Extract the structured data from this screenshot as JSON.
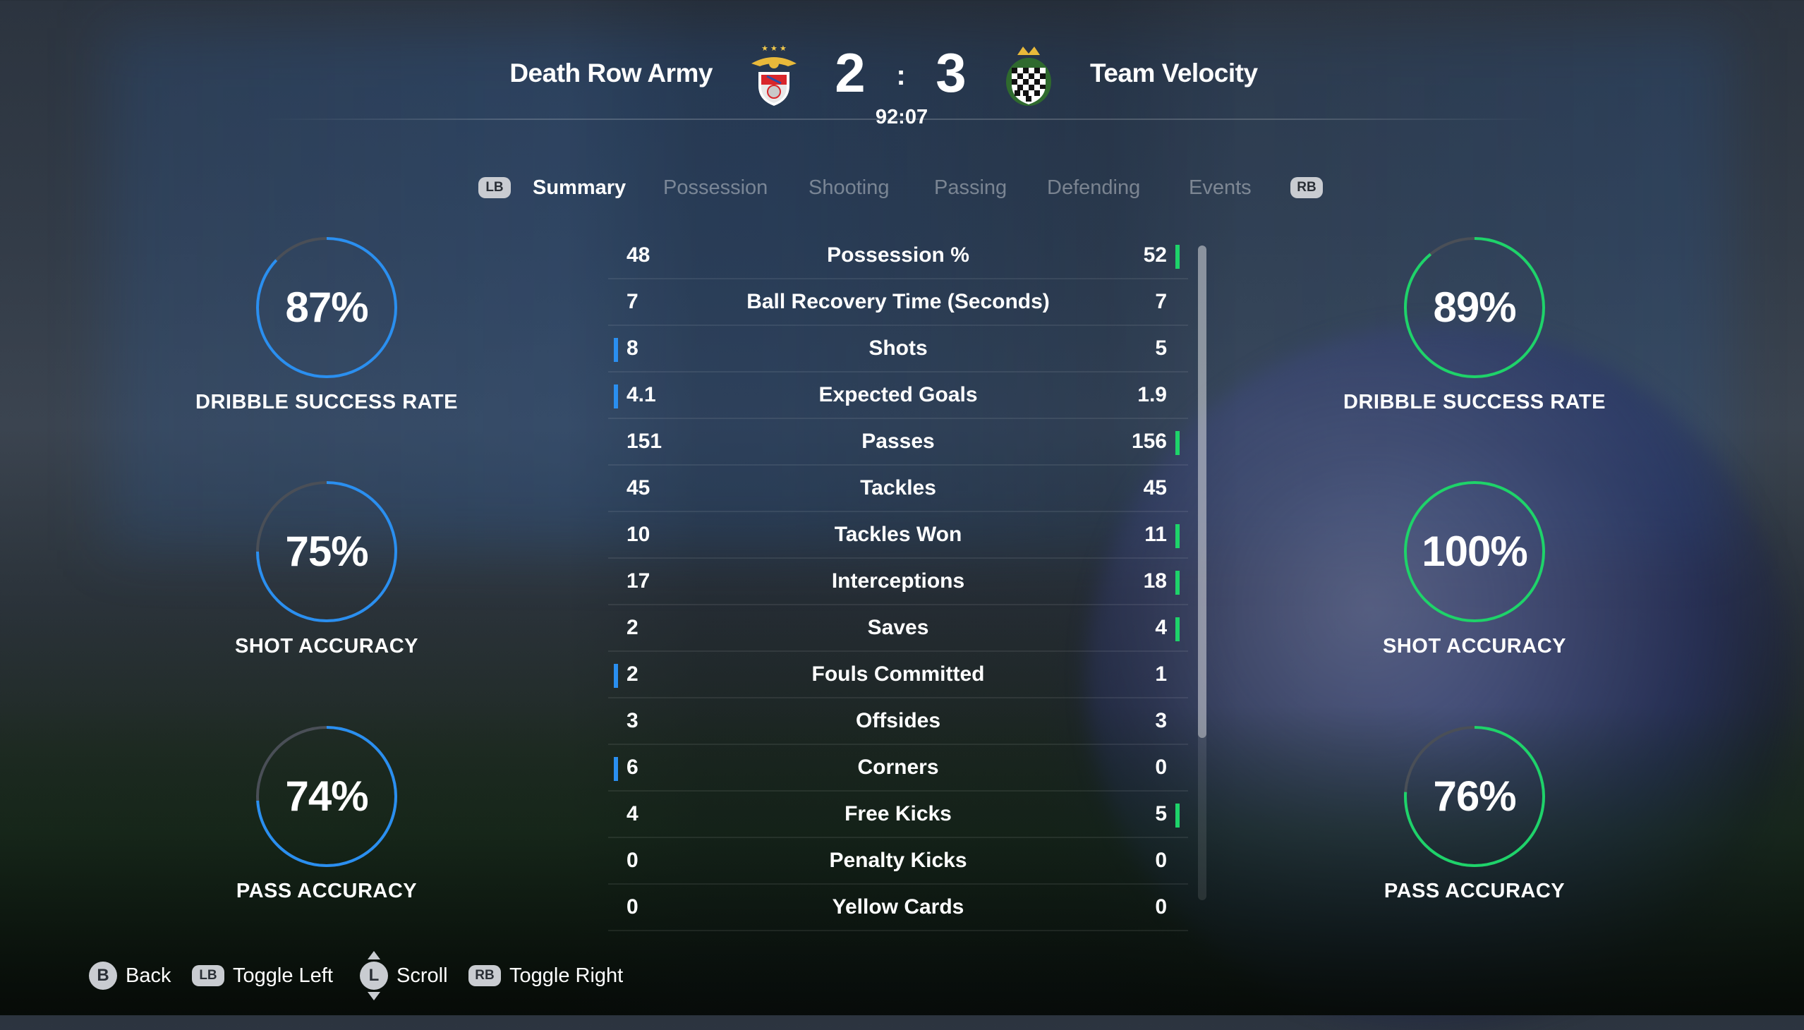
{
  "match": {
    "home_team": "Death Row Army",
    "away_team": "Team Velocity",
    "home_score": "2",
    "away_score": "3",
    "separator": ":",
    "clock": "92:07"
  },
  "tabs": {
    "left_button": "LB",
    "right_button": "RB",
    "items": [
      "Summary",
      "Possession",
      "Shooting",
      "Passing",
      "Defending",
      "Events"
    ],
    "active": "Summary"
  },
  "colors": {
    "home": "#2a8ff0",
    "away": "#1ed36a",
    "ring_track": "#4a4f57"
  },
  "home_rings": [
    {
      "value": "87%",
      "fraction": 0.87,
      "label": "DRIBBLE SUCCESS RATE"
    },
    {
      "value": "75%",
      "fraction": 0.75,
      "label": "SHOT ACCURACY"
    },
    {
      "value": "74%",
      "fraction": 0.74,
      "label": "PASS ACCURACY"
    }
  ],
  "away_rings": [
    {
      "value": "89%",
      "fraction": 0.89,
      "label": "DRIBBLE SUCCESS RATE"
    },
    {
      "value": "100%",
      "fraction": 1.0,
      "label": "SHOT ACCURACY"
    },
    {
      "value": "76%",
      "fraction": 0.76,
      "label": "PASS ACCURACY"
    }
  ],
  "stats": [
    {
      "name": "Possession %",
      "home": "48",
      "away": "52",
      "leader": "away"
    },
    {
      "name": "Ball Recovery Time (Seconds)",
      "home": "7",
      "away": "7",
      "leader": "none"
    },
    {
      "name": "Shots",
      "home": "8",
      "away": "5",
      "leader": "home"
    },
    {
      "name": "Expected Goals",
      "home": "4.1",
      "away": "1.9",
      "leader": "home"
    },
    {
      "name": "Passes",
      "home": "151",
      "away": "156",
      "leader": "away"
    },
    {
      "name": "Tackles",
      "home": "45",
      "away": "45",
      "leader": "none"
    },
    {
      "name": "Tackles Won",
      "home": "10",
      "away": "11",
      "leader": "away"
    },
    {
      "name": "Interceptions",
      "home": "17",
      "away": "18",
      "leader": "away"
    },
    {
      "name": "Saves",
      "home": "2",
      "away": "4",
      "leader": "away"
    },
    {
      "name": "Fouls Committed",
      "home": "2",
      "away": "1",
      "leader": "home"
    },
    {
      "name": "Offsides",
      "home": "3",
      "away": "3",
      "leader": "none"
    },
    {
      "name": "Corners",
      "home": "6",
      "away": "0",
      "leader": "home"
    },
    {
      "name": "Free Kicks",
      "home": "4",
      "away": "5",
      "leader": "away"
    },
    {
      "name": "Penalty Kicks",
      "home": "0",
      "away": "0",
      "leader": "none"
    },
    {
      "name": "Yellow Cards",
      "home": "0",
      "away": "0",
      "leader": "none"
    }
  ],
  "footer": {
    "back_key": "B",
    "back_label": "Back",
    "toggle_left_key": "LB",
    "toggle_left_label": "Toggle Left",
    "scroll_key": "L",
    "scroll_label": "Scroll",
    "toggle_right_key": "RB",
    "toggle_right_label": "Toggle Right"
  }
}
